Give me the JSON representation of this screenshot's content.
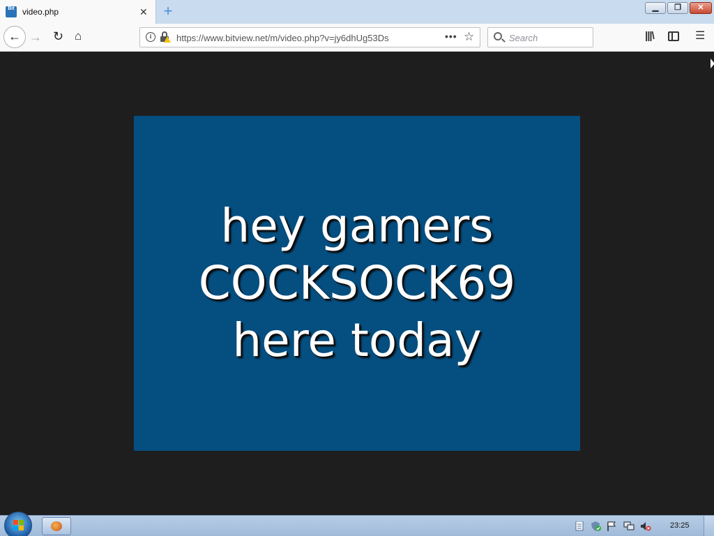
{
  "browser": {
    "tab": {
      "title": "video.php",
      "favicon_text": "Bit",
      "favicon_icon": "bitview-favicon-icon",
      "close_icon": "close-icon"
    },
    "new_tab_icon": "plus-icon",
    "window_controls": {
      "minimize_label": "▭",
      "maximize_label": "❐",
      "close_label": "✕"
    },
    "nav": {
      "back_icon": "←",
      "forward_icon": "→",
      "reload_icon": "↻",
      "home_icon": "⌂"
    },
    "url": "https://www.bitview.net/m/video.php?v=jy6dhUg53Ds",
    "page_actions_label": "•••",
    "bookmark_label": "☆",
    "search": {
      "placeholder": "Search"
    },
    "toolbar": {
      "library_label": "|||\\",
      "menu_label": "☰"
    }
  },
  "video": {
    "background_color": "#054e80",
    "caption_lines": [
      "hey gamers",
      "COCKSOCK69",
      "here today"
    ]
  },
  "taskbar": {
    "clock": "23:25",
    "tray_icons": [
      "document-icon",
      "security-shield-icon",
      "action-center-flag-icon",
      "network-icon",
      "volume-muted-icon"
    ]
  },
  "colors": {
    "accent": "#4a8ede",
    "video_bg": "#054e80",
    "page_bg": "#1e1e1e"
  }
}
